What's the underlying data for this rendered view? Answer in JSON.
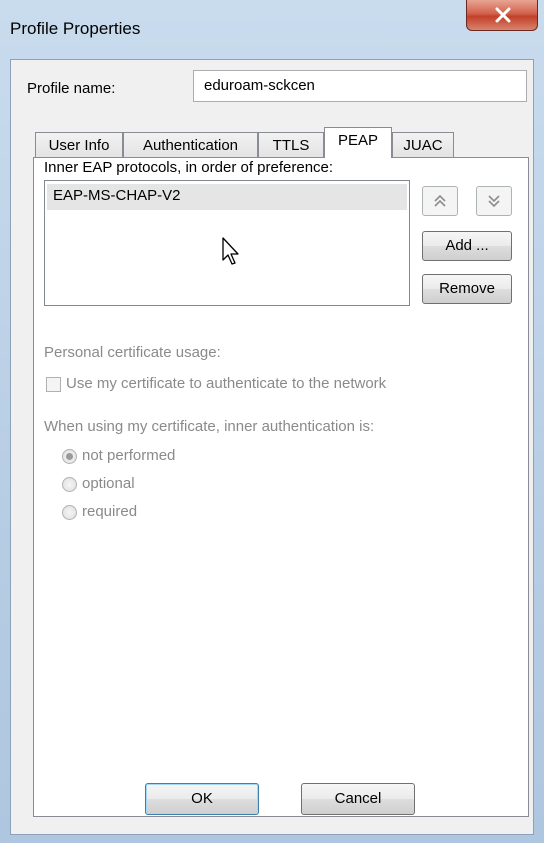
{
  "window": {
    "title": "Profile Properties",
    "close_symbol": "x"
  },
  "profile": {
    "label": "Profile name:",
    "value": "eduroam-sckcen"
  },
  "tabs": [
    {
      "label": "User Info",
      "active": false
    },
    {
      "label": "Authentication",
      "active": false
    },
    {
      "label": "TTLS",
      "active": false
    },
    {
      "label": "PEAP",
      "active": true
    },
    {
      "label": "JUAC",
      "active": false
    }
  ],
  "peap": {
    "inner_label": "Inner EAP protocols, in order of preference:",
    "protocols": [
      "EAP-MS-CHAP-V2"
    ],
    "move_up_icon": "double-chevron-up-icon",
    "move_down_icon": "double-chevron-down-icon",
    "add_label": "Add ...",
    "remove_label": "Remove",
    "cert_usage_label": "Personal certificate usage:",
    "cert_checkbox_label": "Use my certificate to authenticate to the network",
    "cert_checkbox_checked": false,
    "inner_auth_label": "When using my certificate, inner authentication is:",
    "options": [
      {
        "label": "not performed",
        "checked": true
      },
      {
        "label": "optional",
        "checked": false
      },
      {
        "label": "required",
        "checked": false
      }
    ]
  },
  "footer": {
    "ok_label": "OK",
    "cancel_label": "Cancel"
  }
}
